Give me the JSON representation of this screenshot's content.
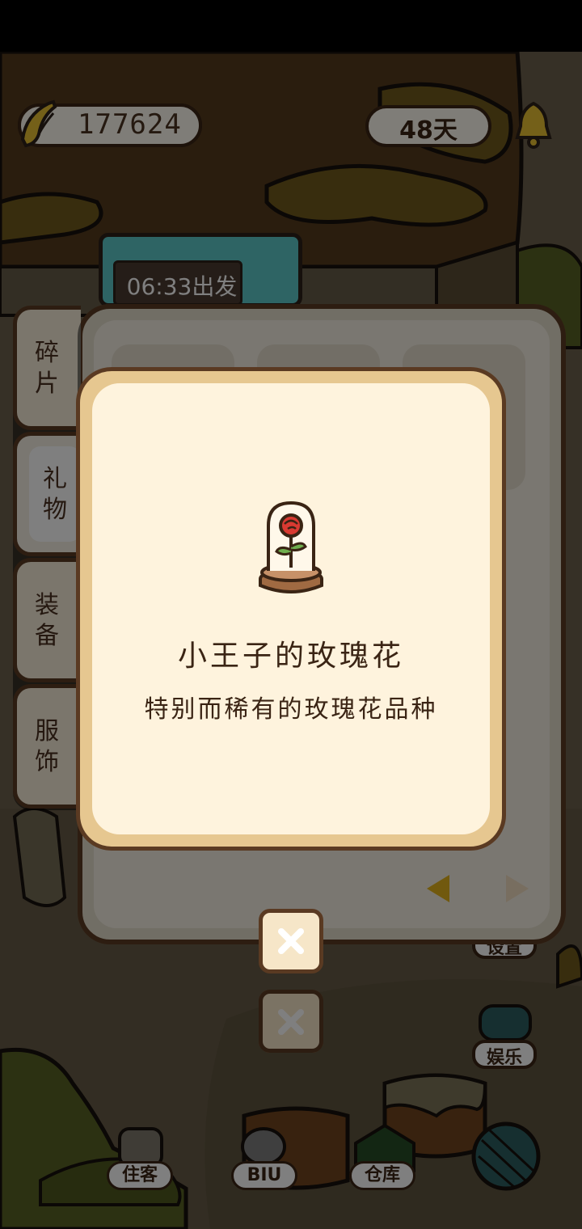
{
  "hud": {
    "banana_count": "177624",
    "days": "48天",
    "departure": "06:33出发"
  },
  "side_buttons": {
    "settings": "设置",
    "entertainment": "娱乐"
  },
  "bottom_bar": {
    "tenants": "住客",
    "biu": "BIU",
    "warehouse": "仓库"
  },
  "inventory": {
    "tabs": [
      "碎片",
      "礼物",
      "装备",
      "服饰"
    ],
    "active_tab": "礼物"
  },
  "popup": {
    "item_name": "小王子的玫瑰花",
    "item_description": "特别而稀有的玫瑰花品种",
    "item_icon": "rose-in-glass-dome-icon"
  },
  "colors": {
    "panel_border": "#5a3a22",
    "popup_frame": "#e6c790",
    "popup_fill": "#fef3dd",
    "text": "#3a2414",
    "arrow_active": "#e3b21c"
  }
}
